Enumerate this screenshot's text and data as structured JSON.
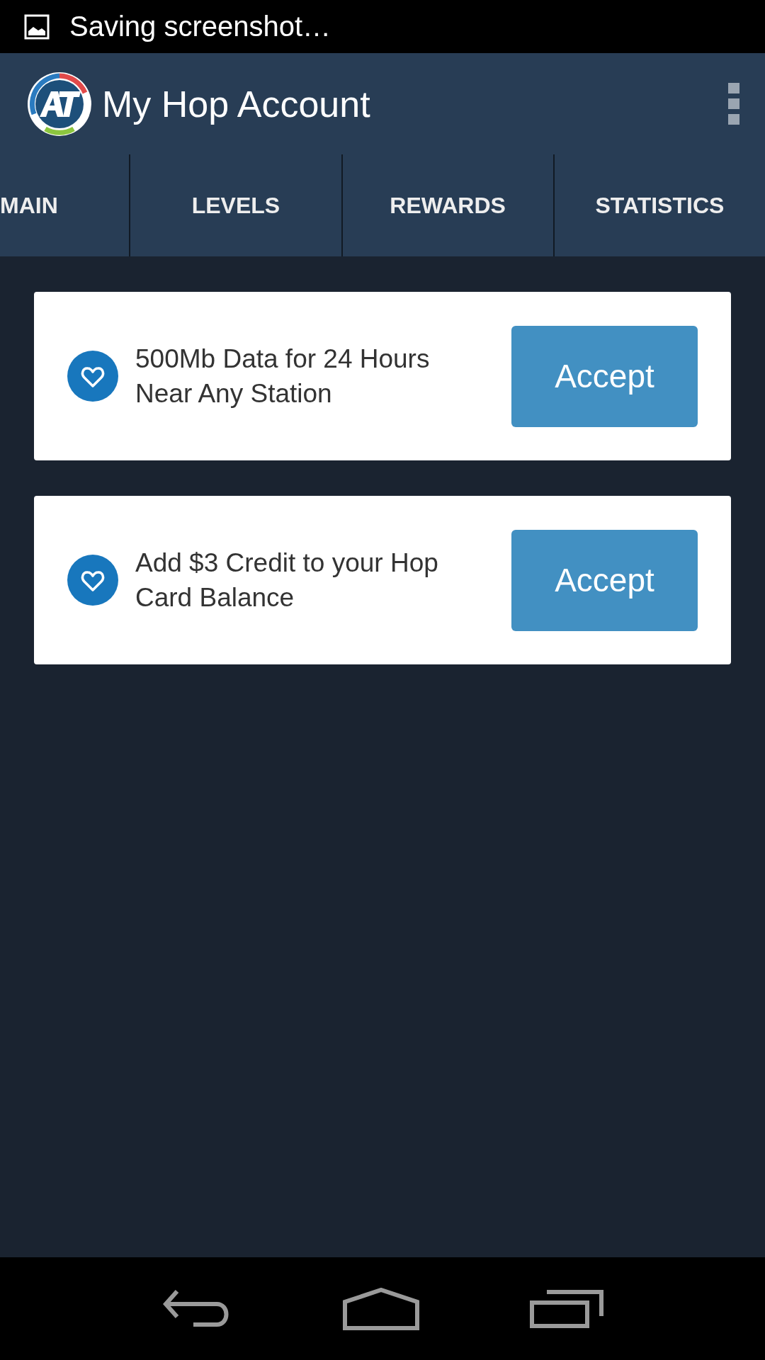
{
  "status_bar": {
    "notification": "Saving screenshot…"
  },
  "app_bar": {
    "title": "My Hop Account"
  },
  "tabs": [
    {
      "label": "MAIN"
    },
    {
      "label": "LEVELS"
    },
    {
      "label": "REWARDS"
    },
    {
      "label": "STATISTICS"
    }
  ],
  "offers": [
    {
      "text": "500Mb Data for 24 Hours Near Any Station",
      "button": "Accept"
    },
    {
      "text": "Add $3 Credit to your Hop Card Balance",
      "button": "Accept"
    }
  ]
}
